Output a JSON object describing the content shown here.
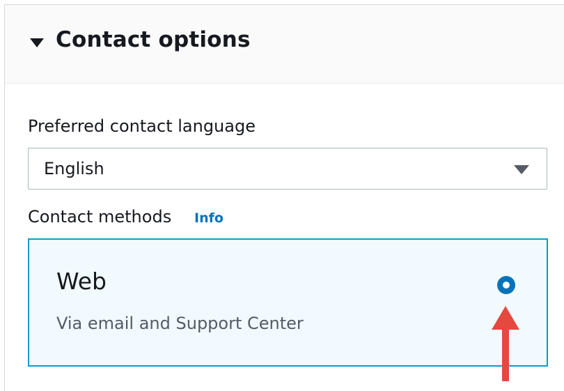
{
  "panel": {
    "title": "Contact options",
    "expanded": true
  },
  "language": {
    "label": "Preferred contact language",
    "selected": "English"
  },
  "contact_methods": {
    "label": "Contact methods",
    "info_link": "Info",
    "options": [
      {
        "title": "Web",
        "description": "Via email and Support Center",
        "selected": true
      }
    ]
  },
  "icons": {
    "panel_toggle": "caret-down-icon",
    "select_toggle": "caret-down-icon",
    "radio": "radio-selected-icon",
    "annotation": "red-arrow-up-icon"
  },
  "colors": {
    "accent": "#0073bb",
    "card_border": "#00a1c9",
    "card_background": "#f1faff",
    "annotation": "#e5483f"
  }
}
